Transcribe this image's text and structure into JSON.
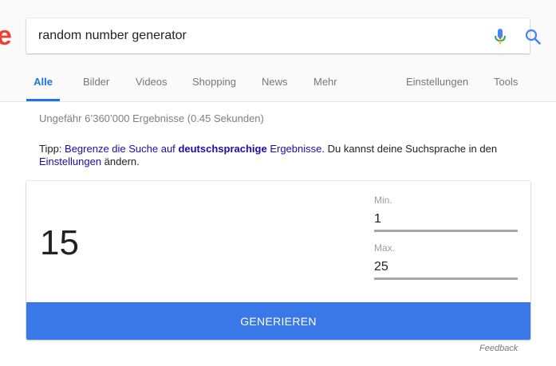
{
  "logo": {
    "fragment": "e"
  },
  "search": {
    "query": "random number generator"
  },
  "tabs": [
    {
      "label": "Alle"
    },
    {
      "label": "Bilder"
    },
    {
      "label": "Videos"
    },
    {
      "label": "Shopping"
    },
    {
      "label": "News"
    },
    {
      "label": "Mehr"
    },
    {
      "label": "Einstellungen"
    },
    {
      "label": "Tools"
    }
  ],
  "results": {
    "stats": "Ungefähr 6’360’000 Ergebnisse (0.45 Sekunden)"
  },
  "tip": {
    "prefix": "Tipp: ",
    "link1": "Begrenze die Suche auf",
    "bold": "deutschsprachige",
    "link2": "Ergebnisse",
    "middle": ". Du kannst deine Suchsprache in den ",
    "settings_link": "Einstellungen",
    "suffix": " ändern."
  },
  "generator": {
    "result": "15",
    "min_label": "Min.",
    "min_value": "1",
    "max_label": "Max.",
    "max_value": "25",
    "button_label": "GENERIEREN"
  },
  "feedback": "Feedback",
  "colors": {
    "accent": "#1a73e8",
    "button": "#3b78e7",
    "link": "#1a0dab"
  },
  "icons": {
    "mic": "microphone-icon",
    "search": "search-icon"
  }
}
